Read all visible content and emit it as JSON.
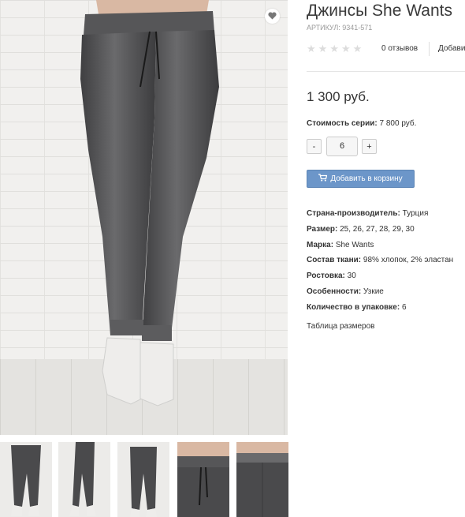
{
  "product": {
    "title": "Джинсы She Wants",
    "sku": "АРТИКУЛ: 9341-571",
    "rating": {
      "stars_total": 5,
      "stars_filled": 0
    },
    "reviews_label": "0 отзывов",
    "add_review_label": "Добави",
    "price": "1 300 руб.",
    "series_label": "Стоимость серии:",
    "series_value": "7 800 руб.",
    "qty": {
      "minus": "-",
      "value": "6",
      "plus": "+"
    },
    "cart_button": "Добавить в корзину",
    "properties": [
      {
        "label": "Страна-производитель:",
        "value": "Турция"
      },
      {
        "label": "Размер:",
        "value": "25, 26, 27, 28, 29, 30"
      },
      {
        "label": "Марка:",
        "value": "She Wants"
      },
      {
        "label": "Состав ткани:",
        "value": "98% хлопок, 2% эластан"
      },
      {
        "label": "Ростовка:",
        "value": "30"
      },
      {
        "label": "Особенности:",
        "value": "Узкие"
      },
      {
        "label": "Количество в упаковке:",
        "value": "6"
      }
    ],
    "size_table_link": "Таблица размеров"
  },
  "icons": {
    "favorite": "heart-icon",
    "cart": "cart-icon",
    "star": "star-icon"
  },
  "colors": {
    "cart_button": "#6c96c9",
    "star_empty": "#dcdcdc",
    "jeans": "#4a4a4c"
  }
}
